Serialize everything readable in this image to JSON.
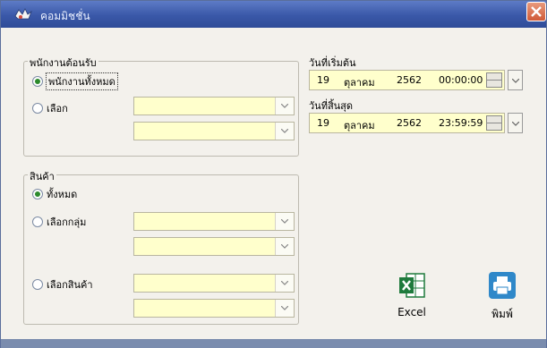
{
  "window": {
    "title": "คอมมิชชั่น",
    "close_label": "Close"
  },
  "colors": {
    "titlebar": "#3a58a8",
    "field": "#ffffcc",
    "close": "#d05a38",
    "excel_green": "#1e7a3c",
    "print_blue": "#2f88c9"
  },
  "employee_group": {
    "title": "พนักงานต้อนรับ",
    "option_all": "พนักงานทั้งหมด",
    "option_select": "เลือก",
    "selected": "all"
  },
  "product_group": {
    "title": "สินค้า",
    "option_all": "ทั้งหมด",
    "option_group": "เลือกกลุ่ม",
    "option_product": "เลือกสินค้า",
    "selected": "all"
  },
  "start": {
    "label": "วันที่เริ่มต้น",
    "day": "19",
    "month": "ตุลาคม",
    "year": "2562",
    "time": "00:00:00"
  },
  "end": {
    "label": "วันที่สิ้นสุด",
    "day": "19",
    "month": "ตุลาคม",
    "year": "2562",
    "time": "23:59:59"
  },
  "actions": {
    "excel_label": "Excel",
    "print_label": "พิมพ์",
    "icons": {
      "excel": "excel-icon",
      "print": "printer-icon"
    }
  }
}
